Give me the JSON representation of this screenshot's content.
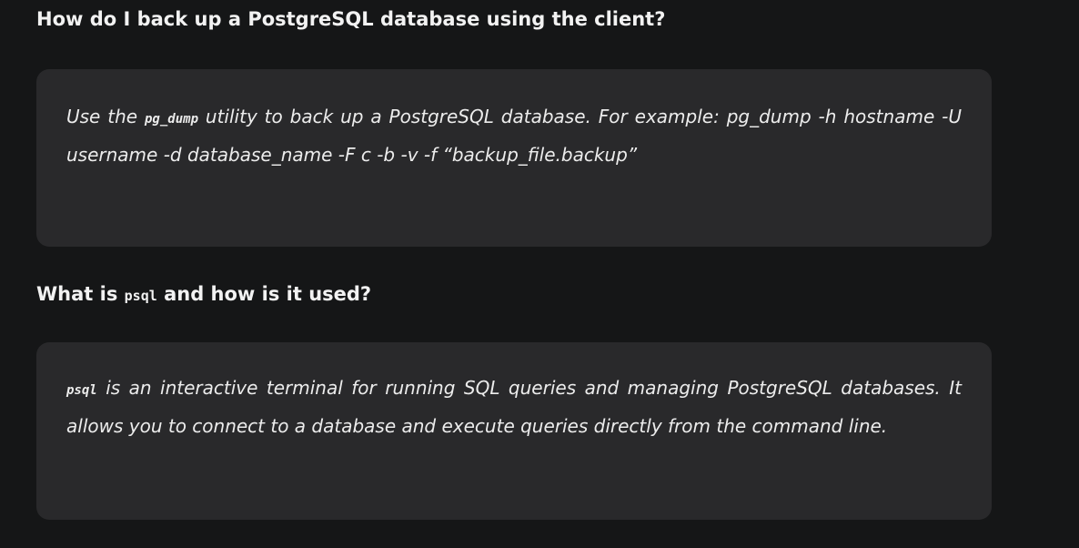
{
  "faq": {
    "q1": {
      "question": "How do I back up a PostgreSQL database using the client?",
      "answer_prefix": "Use the ",
      "answer_code": "pg_dump",
      "answer_suffix": " utility to back up a PostgreSQL database. For example: pg_dump -h hostname -U username -d database_name -F c -b -v -f “backup_file.backup”"
    },
    "q2": {
      "question_prefix": "What is ",
      "question_code": "psql",
      "question_suffix": " and how is it used?",
      "answer_code": "psql",
      "answer_suffix": " is an interactive terminal for running SQL queries and managing PostgreSQL databases. It allows you to connect to a database and execute queries directly from the command line."
    }
  },
  "colors": {
    "page_background": "#151617",
    "card_background": "#29292b",
    "text": "#ececec"
  }
}
